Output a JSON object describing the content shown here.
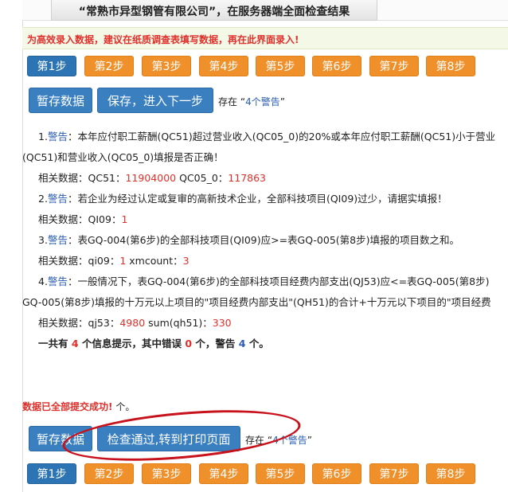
{
  "header": {
    "title": "“常熟市异型钢管有限公司”，在服务器端全面检查结果"
  },
  "notice": {
    "text": "为高效录入数据，建议在纸质调查表填写数据，再在此界面录入!"
  },
  "steps": [
    "第1步",
    "第2步",
    "第3步",
    "第4步",
    "第5步",
    "第6步",
    "第7步",
    "第8步"
  ],
  "active_step": "第1步",
  "actions_top": {
    "temp_save": "暂存数据",
    "save_next": "保存，进入下一步",
    "status_prefix": "存在",
    "status_open": "“",
    "status_warn": "4个警告",
    "status_close": "”"
  },
  "items": [
    {
      "index": "1.",
      "tag": "警告",
      "colon": "：",
      "text_line1": "本年应付职工薪酬(QC51)超过营业收入(QC05_0)的20%或本年应付职工薪酬(QC51)小于营业",
      "text_line2": "(QC51)和营业收入(QC05_0)填报是否正确！",
      "related_label": "相关数据：",
      "related": [
        {
          "key": "QC51：",
          "value": "11904000"
        },
        {
          "key": "QC05_0：",
          "value": "117863"
        }
      ]
    },
    {
      "index": "2.",
      "tag": "警告",
      "colon": "：",
      "text_line1": "若企业为经过认定或复审的高新技术企业，全部科技项目(QI09)过少，请据实填报！",
      "text_line2": "",
      "related_label": "相关数据：",
      "related": [
        {
          "key": "QI09：",
          "value": "1"
        }
      ]
    },
    {
      "index": "3.",
      "tag": "警告",
      "colon": "：",
      "text_line1": "表GQ-004(第6步)的全部科技项目(QI09)应>=表GQ-005(第8步)填报的项目数之和。",
      "text_line2": "",
      "related_label": "相关数据：",
      "related": [
        {
          "key": "qi09：",
          "value": "1"
        },
        {
          "key": "xmcount：",
          "value": "3"
        }
      ]
    },
    {
      "index": "4.",
      "tag": "警告",
      "colon": "：",
      "text_line1": "一般情况下，表GQ-004(第6步)的全部科技项目经费内部支出(QJ53)应<=表GQ-005(第8步)",
      "text_line2": "GQ-005(第8步)填报的十万元以上项目的\"项目经费内部支出\"(QH51)的合计+十万元以下项目的\"项目经费",
      "related_label": "相关数据：",
      "related": [
        {
          "key": "qj53：",
          "value": "4980"
        },
        {
          "key": "sum(qh51)：",
          "value": "330"
        }
      ]
    }
  ],
  "summary": {
    "prefix": "一共有",
    "total": "4",
    "mid1": "个信息提示，其中错误",
    "errors": "0",
    "mid2": "个，警告",
    "warnings": "4",
    "suffix": "个。"
  },
  "success": {
    "text": "数据已全部提交成功!",
    "suffix": "个。"
  },
  "actions_bottom": {
    "temp_save": "暂存数据",
    "check_print": "检查通过,转到打印页面",
    "status_prefix": "存在",
    "status_open": "“",
    "status_warn": "4个警告",
    "status_close": "”"
  },
  "colors": {
    "step_orange": "#f0902a",
    "step_active_blue": "#2c74b4",
    "button_blue": "#3a7fc0",
    "warning_red": "#e0302b",
    "link_blue": "#2a5db0",
    "annotation_red": "#c8121b"
  }
}
